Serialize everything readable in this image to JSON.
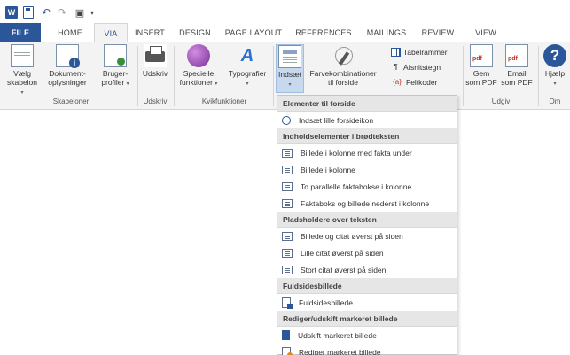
{
  "qat": {
    "word_logo": "W",
    "undo_symbol": "↶",
    "redo_symbol": "↷",
    "preview_symbol": "▣",
    "more_symbol": "▾"
  },
  "tabs": [
    "FILE",
    "HOME",
    "VIA",
    "INSERT",
    "DESIGN",
    "PAGE LAYOUT",
    "REFERENCES",
    "MAILINGS",
    "REVIEW",
    "VIEW"
  ],
  "active_tab": "VIA",
  "ribbon": {
    "skabeloner": {
      "group": "Skabeloner",
      "vaelg": [
        "Vælg",
        "skabelon"
      ],
      "dokument": [
        "Dokument-",
        "oplysninger"
      ],
      "bruger": [
        "Bruger-",
        "profiler"
      ]
    },
    "udskriv": {
      "group": "Udskriv",
      "btn": "Udskriv"
    },
    "kvikfunktioner": {
      "group": "Kvikfunktioner",
      "specielle": [
        "Specielle",
        "funktioner"
      ],
      "typografier": "Typografier"
    },
    "indsaet": {
      "btn": "Indsæt",
      "farve": [
        "Farvekombinationer",
        "til forside"
      ],
      "tabelrammer": "Tabelrammer",
      "afsnitstegn": "Afsnitstegn",
      "feltkoder": "Feltkoder",
      "afsnit_symbol": "¶",
      "felt_symbol": "{a}"
    },
    "udgiv": {
      "group": "Udgiv",
      "gem": [
        "Gem",
        "som PDF"
      ],
      "email": [
        "Email",
        "som PDF"
      ]
    },
    "om": {
      "group": "Om",
      "help": "Hjælp",
      "help_symbol": "?"
    },
    "caret": "▾"
  },
  "menu": {
    "sections": [
      {
        "header": "Elementer til forside",
        "items": [
          {
            "label": "Indsæt lille forsideikon",
            "icon": "circle"
          }
        ]
      },
      {
        "header": "Indholdselementer i brødteksten",
        "items": [
          {
            "label": "Billede i kolonne med fakta under",
            "icon": "box"
          },
          {
            "label": "Billede i kolonne",
            "icon": "box"
          },
          {
            "label": "To parallelle faktabokse i kolonne",
            "icon": "box"
          },
          {
            "label": "Faktaboks og billede nederst i kolonne",
            "icon": "box"
          }
        ]
      },
      {
        "header": "Pladsholdere over teksten",
        "items": [
          {
            "label": "Billede og citat øverst på siden",
            "icon": "box"
          },
          {
            "label": "Lille citat øverst på siden",
            "icon": "box"
          },
          {
            "label": "Stort citat øverst på siden",
            "icon": "box"
          }
        ]
      },
      {
        "header": "Fuldsidesbillede",
        "items": [
          {
            "label": "Fuldsidesbillede",
            "icon": "page"
          }
        ]
      },
      {
        "header": "Rediger/udskift markeret billede",
        "items": [
          {
            "label": "Udskift markeret billede",
            "icon": "swap"
          },
          {
            "label": "Rediger markeret billede",
            "icon": "edit"
          }
        ]
      }
    ]
  },
  "colors": {
    "accent": "#2b579a",
    "ribbon_bg": "#f3f3f3",
    "pressed": "#c8d9ee"
  }
}
